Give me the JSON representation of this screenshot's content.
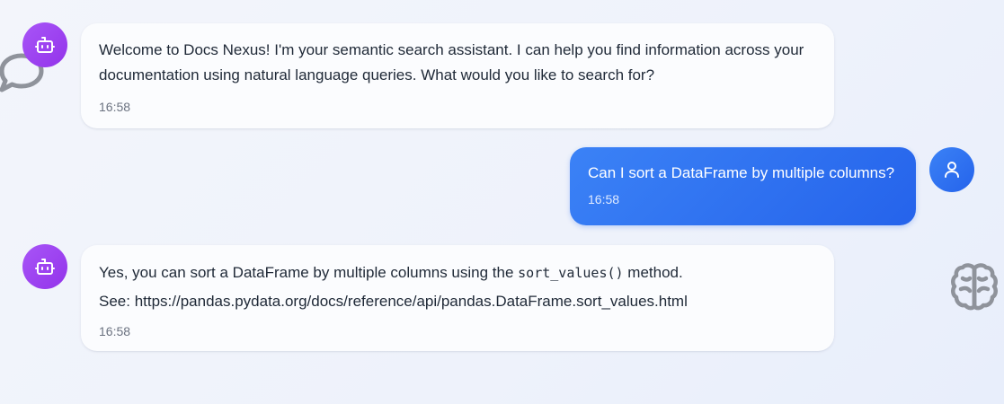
{
  "messages": [
    {
      "role": "bot",
      "avatar_icon": "robot-icon",
      "text": "Welcome to Docs Nexus! I'm your semantic search assistant. I can help you find information across your documentation using natural language queries. What would you like to search for?",
      "time": "16:58"
    },
    {
      "role": "user",
      "avatar_icon": "user-icon",
      "text": "Can I sort a DataFrame by multiple columns?",
      "time": "16:58"
    },
    {
      "role": "bot",
      "avatar_icon": "robot-icon",
      "text_before_code": "Yes, you can sort a DataFrame by multiple columns using the ",
      "code": "sort_values()",
      "text_after_code": " method.",
      "see_line": "See: https://pandas.pydata.org/docs/reference/api/pandas.DataFrame.sort_values.html",
      "time": "16:58"
    }
  ],
  "decorations": {
    "left_icon": "chat-bubble-icon",
    "right_icon": "brain-icon"
  },
  "colors": {
    "bot_avatar": "#a855f7",
    "user_accent": "#2563eb",
    "decor_icon": "#8f939b"
  }
}
